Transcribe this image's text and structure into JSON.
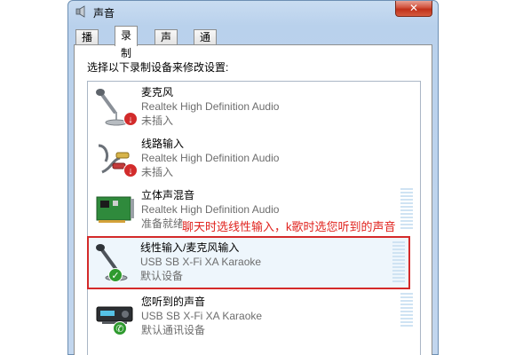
{
  "window": {
    "title": "声音",
    "close_label": "✕"
  },
  "tabs": [
    {
      "label": "播放",
      "active": false
    },
    {
      "label": "录制",
      "active": true
    },
    {
      "label": "声音",
      "active": false
    },
    {
      "label": "通信",
      "active": false
    }
  ],
  "panel": {
    "instruction": "选择以下录制设备来修改设置:"
  },
  "devices": [
    {
      "name": "麦克风",
      "driver": "Realtek High Definition Audio",
      "status": "未插入",
      "icon": "microphone-icon",
      "badge": "unplugged"
    },
    {
      "name": "线路输入",
      "driver": "Realtek High Definition Audio",
      "status": "未插入",
      "icon": "line-in-cable-icon",
      "badge": "unplugged"
    },
    {
      "name": "立体声混音",
      "driver": "Realtek High Definition Audio",
      "status": "准备就绪",
      "icon": "sound-card-icon",
      "badge": "none"
    },
    {
      "name": "线性输入/麦克风输入",
      "driver": "USB SB X-Fi XA Karaoke",
      "status": "默认设备",
      "icon": "microphone-icon",
      "badge": "default",
      "selected": true
    },
    {
      "name": "您听到的声音",
      "driver": "USB SB X-Fi XA Karaoke",
      "status": "默认通讯设备",
      "icon": "usb-sound-device-icon",
      "badge": "default-comm"
    }
  ],
  "annotation": "聊天时选线性输入，k歌时选您听到的声音",
  "colors": {
    "annotation": "#e0231e",
    "selection_border": "#d42a2a",
    "badge_unplugged": "#d22b2b",
    "badge_default": "#2e9a2e"
  }
}
